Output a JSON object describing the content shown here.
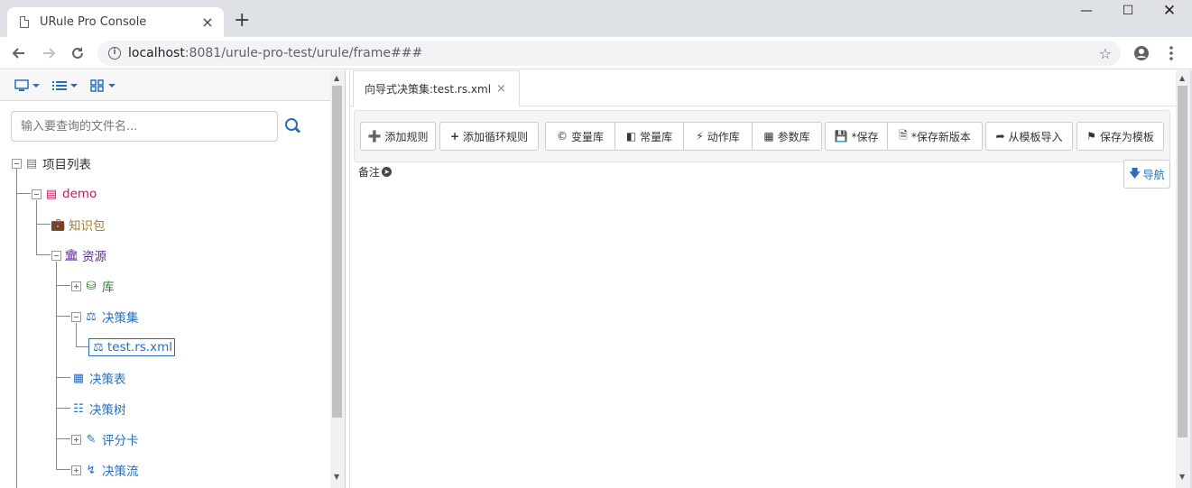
{
  "browser": {
    "tab_title": "URule Pro Console",
    "tab_close": "×",
    "new_tab": "+",
    "url_host": "localhost",
    "url_path": ":8081/urule-pro-test/urule/frame###"
  },
  "left_panel": {
    "search_placeholder": "输入要查询的文件名...",
    "tree": {
      "root": "项目列表",
      "project": "demo",
      "knowledge_package": "知识包",
      "resources": "资源",
      "library": "库",
      "decision_set": "决策集",
      "selected_file": "test.rs.xml",
      "decision_table": "决策表",
      "decision_tree": "决策树",
      "scorecard": "评分卡",
      "decision_flow": "决策流"
    }
  },
  "editor": {
    "tab_label": "向导式决策集:test.rs.xml",
    "tab_close": "×",
    "buttons": {
      "add_rule": "添加规则",
      "add_loop_rule": "添加循环规则",
      "variable_lib": "变量库",
      "constant_lib": "常量库",
      "action_lib": "动作库",
      "parameter_lib": "参数库",
      "save": "*保存",
      "save_new_version": "*保存新版本",
      "import_from_template": "从模板导入",
      "save_as_template": "保存为模板"
    },
    "remark_label": "备注",
    "nav_label": "导航"
  },
  "colors": {
    "accent": "#2a6ebb",
    "project": "#c0185a",
    "package": "#a0822a",
    "resources": "#5b2d91",
    "library": "#2f7d32"
  }
}
